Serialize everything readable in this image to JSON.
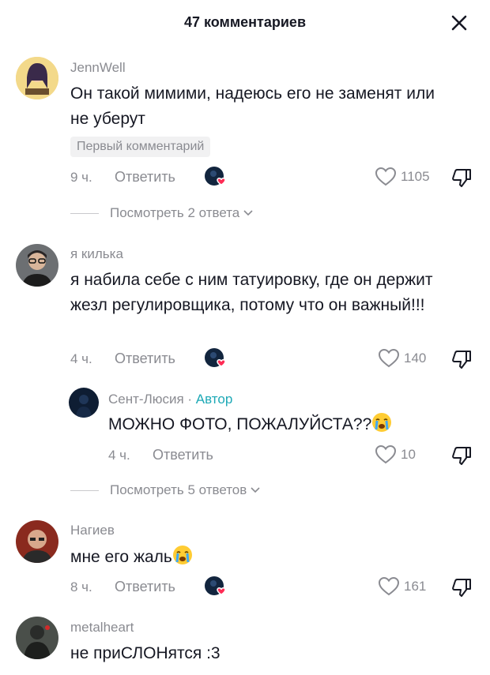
{
  "header": {
    "title": "47 комментариев"
  },
  "comments": [
    {
      "username": "JennWell",
      "text": "Он такой мимими, надеюсь его не заменят или не уберут",
      "badge": "Первый комментарий",
      "time": "9 ч.",
      "reply_label": "Ответить",
      "likes": "1105",
      "view_replies": "Посмотреть 2 ответа"
    },
    {
      "username": "я килька",
      "text": "я набила себе с ним татуировку, где он держит жезл регулировщика, потому что он важный!!!",
      "time": "4 ч.",
      "reply_label": "Ответить",
      "likes": "140",
      "reply": {
        "username": "Сент-Люсия",
        "separator": " · ",
        "author_tag": "Автор",
        "text": "МОЖНО ФОТО, ПОЖАЛУЙСТА??",
        "time": "4 ч.",
        "reply_label": "Ответить",
        "likes": "10"
      },
      "view_replies": "Посмотреть 5 ответов"
    },
    {
      "username": "Нагиев",
      "text": "мне его жаль",
      "time": "8 ч.",
      "reply_label": "Ответить",
      "likes": "161"
    },
    {
      "username": "metalheart",
      "text": "не приСЛОНятся :3"
    }
  ],
  "colors": {
    "accent_author": "#1ea9b6",
    "like_heart": "#fe2c55",
    "muted": "#8a8b91"
  },
  "icons": [
    "close-icon",
    "heart-outline-icon",
    "dislike-icon",
    "chevron-down-icon",
    "crying-emoji-icon",
    "author-liked-icon"
  ]
}
